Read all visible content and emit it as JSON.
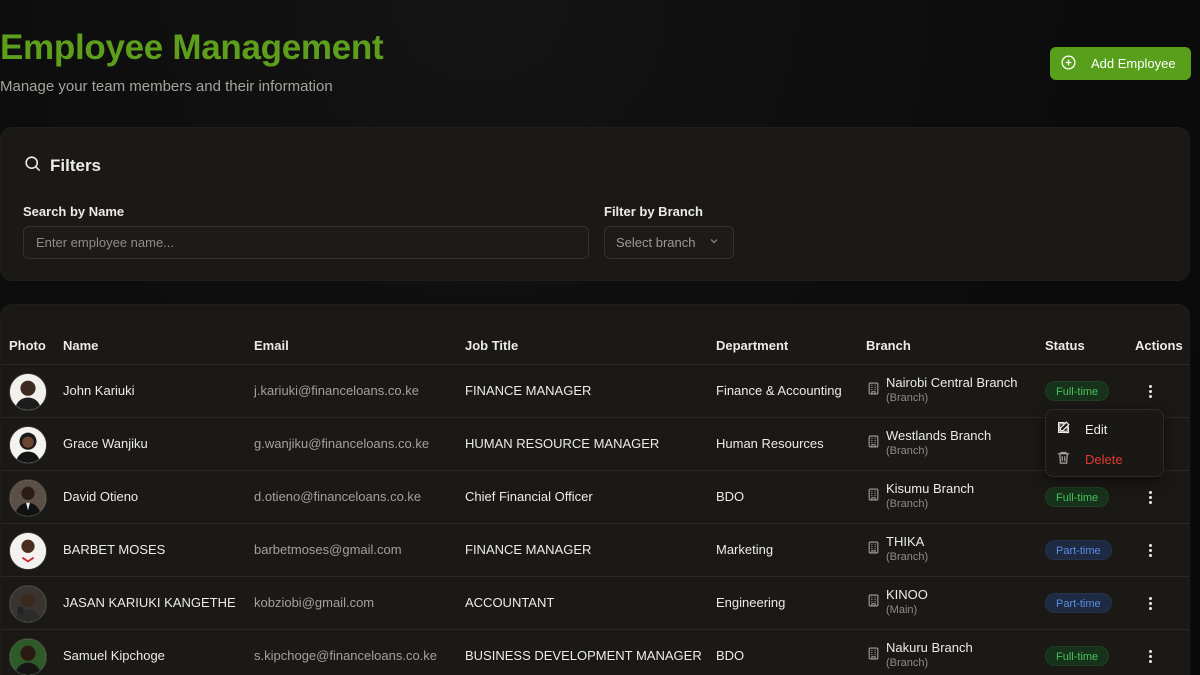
{
  "header": {
    "title": "Employee Management",
    "subtitle": "Manage your team members and their information",
    "add_label": "Add Employee"
  },
  "filters": {
    "title": "Filters",
    "search_label": "Search by Name",
    "search_placeholder": "Enter employee name...",
    "branch_label": "Filter by Branch",
    "branch_placeholder": "Select branch"
  },
  "table": {
    "columns": [
      "Photo",
      "Name",
      "Email",
      "Job Title",
      "Department",
      "Branch",
      "Status",
      "Actions"
    ],
    "rows": [
      {
        "name": "John Kariuki",
        "email": "j.kariuki@financeloans.co.ke",
        "job": "FINANCE MANAGER",
        "dept": "Finance & Accounting",
        "branch": "Nairobi Central Branch",
        "branch_type": "(Branch)",
        "status": "Full-time"
      },
      {
        "name": "Grace Wanjiku",
        "email": "g.wanjiku@financeloans.co.ke",
        "job": "HUMAN RESOURCE MANAGER",
        "dept": "Human Resources",
        "branch": "Westlands Branch",
        "branch_type": "(Branch)",
        "status": ""
      },
      {
        "name": "David Otieno",
        "email": "d.otieno@financeloans.co.ke",
        "job": "Chief Financial Officer",
        "dept": "BDO",
        "branch": "Kisumu Branch",
        "branch_type": "(Branch)",
        "status": "Full-time"
      },
      {
        "name": "BARBET MOSES",
        "email": "barbetmoses@gmail.com",
        "job": "FINANCE MANAGER",
        "dept": "Marketing",
        "branch": "THIKA",
        "branch_type": "(Branch)",
        "status": "Part-time"
      },
      {
        "name": "JASAN KARIUKI KANGETHE",
        "email": "kobziobi@gmail.com",
        "job": "ACCOUNTANT",
        "dept": "Engineering",
        "branch": "KINOO",
        "branch_type": "(Main)",
        "status": "Part-time"
      },
      {
        "name": "Samuel Kipchoge",
        "email": "s.kipchoge@financeloans.co.ke",
        "job": "BUSINESS DEVELOPMENT MANAGER",
        "dept": "BDO",
        "branch": "Nakuru Branch",
        "branch_type": "(Branch)",
        "status": "Full-time"
      }
    ]
  },
  "menu": {
    "edit_label": "Edit",
    "delete_label": "Delete"
  },
  "colors": {
    "accent": "#5d9e1c",
    "button": "#58a01c",
    "full_time": "#48c25c",
    "part_time": "#5b8ee4",
    "danger": "#e03b33"
  },
  "icons": {
    "add": "plus-circle-icon",
    "filters": "search-icon",
    "select": "chevron-down-icon",
    "branch": "building-icon",
    "actions": "more-vertical-icon",
    "edit": "edit-icon",
    "delete": "trash-icon"
  }
}
